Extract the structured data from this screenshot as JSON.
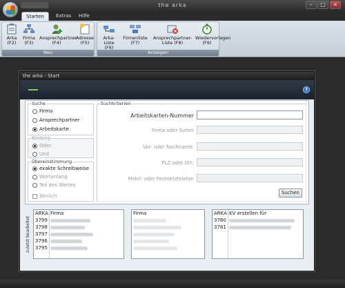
{
  "window": {
    "title": "the arka"
  },
  "ribbon_tabs": [
    {
      "label": "Starten"
    },
    {
      "label": "Extras"
    },
    {
      "label": "Hilfe"
    }
  ],
  "groups": {
    "neu": {
      "label": "Neu",
      "buttons": [
        {
          "label": "Arka",
          "key": "(F2)",
          "icon": "clipboard-icon"
        },
        {
          "label": "Firma",
          "key": "(F3)",
          "icon": "org-chart-icon"
        },
        {
          "label": "Ansprechpartner",
          "key": "(F4)",
          "icon": "add-person-icon"
        },
        {
          "label": "Adresse",
          "key": "(F5)",
          "icon": "new-document-icon"
        }
      ]
    },
    "anzeigen": {
      "label": "Anzeigen",
      "buttons": [
        {
          "label": "Arka-Liste",
          "key": "(F6)",
          "icon": "network-list-icon"
        },
        {
          "label": "Firmenliste",
          "key": "(F7)",
          "icon": "company-list-icon"
        },
        {
          "label": "Ansprechpartner-",
          "label2": "Liste (F8)",
          "icon": "contact-list-icon"
        },
        {
          "label": "Wiedervorlagen",
          "key": "(F9)",
          "icon": "stopwatch-icon"
        }
      ]
    }
  },
  "dialog": {
    "title": "the arka - Start",
    "suche": {
      "legend": "Suche",
      "options": [
        {
          "label": "Firma",
          "selected": false
        },
        {
          "label": "Ansprechpartner",
          "selected": false
        },
        {
          "label": "Arbeitskarte",
          "selected": true
        }
      ]
    },
    "bindung": {
      "legend": "Bindung",
      "options": [
        {
          "label": "Oder",
          "selected": true
        },
        {
          "label": "Und",
          "selected": false
        }
      ]
    },
    "uebereinstimmung": {
      "legend": "Übereinstimmung",
      "options": [
        {
          "label": "exakte Schreibweise",
          "selected": true
        },
        {
          "label": "Wortanfang",
          "selected": false
        },
        {
          "label": "Teil des Wertes",
          "selected": false
        }
      ],
      "checkbox": "ähnlich"
    },
    "suchkriterien": {
      "legend": "Suchkriterien",
      "fields": [
        {
          "label": "Arbeitskarten-Nummer",
          "value": "",
          "enabled": true
        },
        {
          "label": "Firma oder Sorter",
          "value": "",
          "enabled": false
        },
        {
          "label": "Vor- oder Nachname:",
          "value": "",
          "enabled": false
        },
        {
          "label": "PLZ oder Ort:",
          "value": "",
          "enabled": false
        },
        {
          "label": "Mobil- oder Festnetztelefon",
          "value": "",
          "enabled": false
        }
      ],
      "search_button": "Suchen"
    },
    "side_label": "zuletzt bearbeitet",
    "list1": {
      "headers": [
        "ARKA",
        "Firma"
      ],
      "rows": [
        {
          "arka": "3799"
        },
        {
          "arka": "3798"
        },
        {
          "arka": "3797"
        },
        {
          "arka": "3796"
        },
        {
          "arka": "3795"
        }
      ]
    },
    "list2": {
      "headers": [
        "Firma"
      ]
    },
    "list3": {
      "headers": [
        "ARKA",
        "KV erstellen für"
      ],
      "rows": [
        {
          "arka": "3780"
        },
        {
          "arka": "3781"
        }
      ]
    }
  }
}
